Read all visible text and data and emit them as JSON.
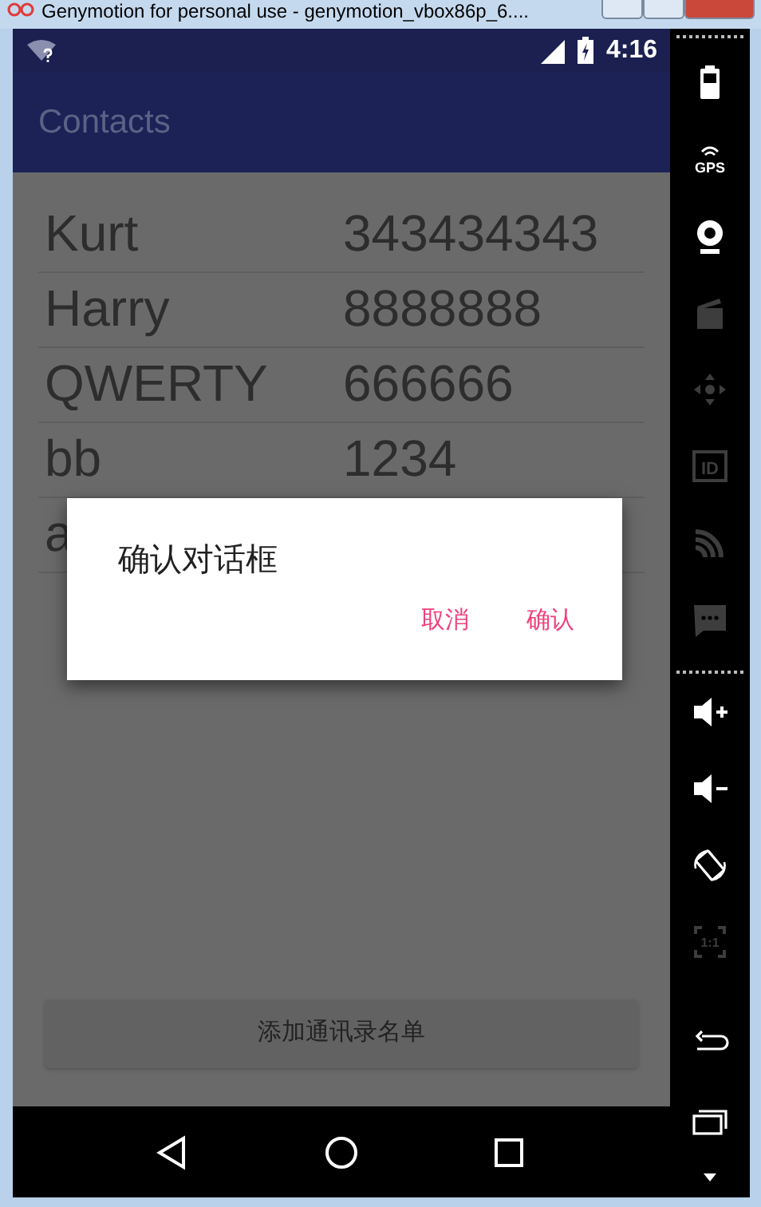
{
  "window": {
    "title": "Genymotion for personal use - genymotion_vbox86p_6...."
  },
  "status_bar": {
    "time": "4:16"
  },
  "app_bar": {
    "title": "Contacts"
  },
  "contacts": [
    {
      "name": "Kurt",
      "phone": "343434343"
    },
    {
      "name": "Harry",
      "phone": "8888888"
    },
    {
      "name": "QWERTY",
      "phone": "666666"
    },
    {
      "name": "bb",
      "phone": "1234"
    },
    {
      "name": "a"
    }
  ],
  "add_button": {
    "label": "添加通讯录名单"
  },
  "dialog": {
    "title": "确认对话框",
    "buttons": [
      "取消",
      "确认"
    ]
  },
  "nav_bar": {
    "buttons": [
      {
        "kind": "back"
      },
      {
        "kind": "home"
      },
      {
        "kind": "recents"
      }
    ]
  },
  "sidebar": {
    "top_tools": [
      {
        "kind": "battery",
        "disabled": false
      },
      {
        "kind": "gps",
        "label": "GPS",
        "disabled": false
      },
      {
        "kind": "camera",
        "disabled": false
      },
      {
        "kind": "media",
        "disabled": true
      },
      {
        "kind": "dpad",
        "disabled": true
      },
      {
        "kind": "id",
        "label": "ID",
        "disabled": true
      },
      {
        "kind": "rss",
        "disabled": true
      },
      {
        "kind": "sms",
        "disabled": true
      }
    ],
    "bottom_tools": [
      {
        "kind": "volume-up",
        "disabled": false
      },
      {
        "kind": "volume-down",
        "disabled": false
      },
      {
        "kind": "rotate",
        "disabled": false
      },
      {
        "kind": "pixel",
        "label": "1:1",
        "disabled": true
      }
    ],
    "nav_tools": [
      {
        "kind": "back",
        "disabled": false
      },
      {
        "kind": "recents",
        "disabled": false
      },
      {
        "kind": "more",
        "disabled": false
      }
    ]
  }
}
